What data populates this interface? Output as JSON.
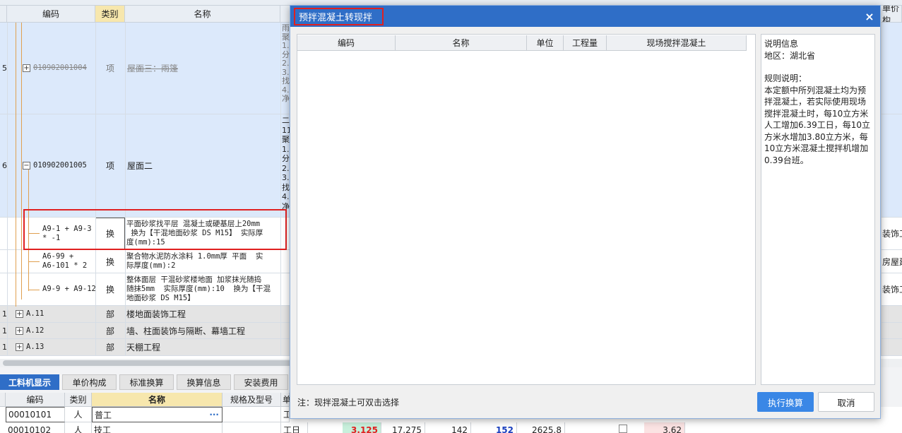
{
  "grid": {
    "headers": {
      "code": "编码",
      "type": "类别",
      "name": "名称",
      "unit_price": "单价构"
    },
    "rows": [
      {
        "num": "5",
        "code": "010902001004",
        "type": "项",
        "name": "屋面三：雨篷",
        "desc": "雨\n聚\n1.\n分\n2.\n3.\n找\n4.\n净",
        "struck": true
      },
      {
        "num": "6",
        "code": "010902001005",
        "type": "项",
        "name": "屋面二",
        "desc": "二\n11\n聚\n1.\n分\n2.\n3.\n找\n4.\n净"
      },
      {
        "code": "A9-1 + A9-3\n* -1",
        "type": "换",
        "name": "平面砂浆找平层 混凝土或硬基层上20mm\n 换为【干混地面砂浆 DS M15】 实际厚\n度(mm):15",
        "right": "装饰工程"
      },
      {
        "code": "A6-99 +\nA6-101 * 2",
        "type": "换",
        "name": "聚合物水泥防水涂料 1.0mm厚 平面  实\n际厚度(mm):2",
        "right": "房屋建筑"
      },
      {
        "code": "A9-9 + A9-12",
        "type": "换",
        "name": "整体面层 干混砂浆楼地面 加浆抹光随捣\n随抹5mm  实际厚度(mm):10  换为【干混\n地面砂浆 DS M15】",
        "right": "装饰工程"
      },
      {
        "num": "1",
        "code": "A.11",
        "type": "部",
        "name": "楼地面装饰工程"
      },
      {
        "num": "1",
        "code": "A.12",
        "type": "部",
        "name": "墙、柱面装饰与隔断、幕墙工程"
      },
      {
        "num": "1",
        "code": "A.13",
        "type": "部",
        "name": "天棚工程"
      }
    ]
  },
  "bottom": {
    "tabs": [
      "工料机显示",
      "单价构成",
      "标准换算",
      "换算信息",
      "安装费用"
    ],
    "headers": [
      "编码",
      "类别",
      "名称",
      "规格及型号",
      "单"
    ],
    "rows": [
      {
        "code": "00010101",
        "type": "人",
        "name": "普工",
        "unit": "工",
        "ellipsis": "···"
      },
      {
        "code": "00010102",
        "type": "人",
        "name": "技工",
        "unit": "工日",
        "v1": "3.125",
        "v2": "17.275",
        "v3": "142",
        "v4": "152",
        "v5": "2625.8",
        "v6": "3.62"
      }
    ]
  },
  "dialog": {
    "title": "预拌混凝土转现拌",
    "close": "×",
    "columns": [
      "编码",
      "名称",
      "单位",
      "工程量",
      "现场搅拌混凝土"
    ],
    "info_title": "说明信息",
    "region": "地区：湖北省",
    "rule_title": "规则说明：",
    "rule_text": "本定额中所列混凝土均为预拌混凝土，若实际使用现场搅拌混凝土时，每10立方米人工增加6.39工日，每10立方米水增加3.80立方米，每10立方米混凝土搅拌机增加0.39台班。",
    "note": "注：现拌混凝土可双击选择",
    "execute": "执行换算",
    "cancel": "取消"
  },
  "colors": {
    "accent": "#2f6ec7",
    "highlight": "#e02020",
    "selected_header": "#f7e7ad"
  }
}
